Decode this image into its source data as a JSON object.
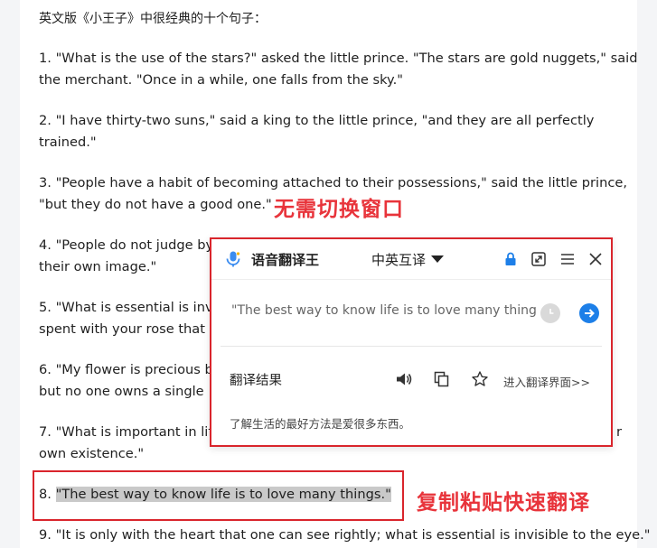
{
  "document": {
    "intro": "英文版《小王子》中很经典的十个句子：",
    "paragraphs": [
      {
        "line1": "1. \"What is the use of the stars?\" asked the little prince. \"The stars are gold nuggets,\" said",
        "line2": "the merchant. \"Once in a while, one falls from the sky.\""
      },
      {
        "line1": "2. \"I have thirty-two suns,\" said a king to the little prince, \"and they are all perfectly",
        "line2": "trained.\""
      },
      {
        "line1": "3. \"People have a habit of becoming attached to their possessions,\" said the little prince,",
        "line2": "\"but they do not have a good one.\""
      },
      {
        "line1": "4. \"People do not judge by",
        "line2": "their own image.\""
      },
      {
        "line1": "5. \"What is essential is inv",
        "line2": "spent with your rose that m"
      },
      {
        "line1": "6. \"My flower is precious b",
        "line2": "but no one owns a single"
      },
      {
        "line1": "7. \"What is important in lif",
        "line1_end": "r",
        "line2": "own existence.\""
      }
    ],
    "p8_prefix": "8. ",
    "p8_highlight": "\"The best way to know life is to love many things.\"",
    "p9": "9. \"It is only with the heart that one can see rightly; what is essential is invisible to the eye.\""
  },
  "annotations": {
    "no_switch": "无需切换窗口",
    "copy_paste": "复制粘贴快速翻译"
  },
  "translator": {
    "title": "语音翻译王",
    "lang_mode": "中英互译",
    "query": "\"The best way to know life is to love many thing",
    "result_label": "翻译结果",
    "enter_link": "进入翻译界面>>",
    "result_text": "了解生活的最好方法是爱很多东西。"
  },
  "colors": {
    "accent": "#1d7fe8",
    "annotation_red": "#e8343b"
  }
}
